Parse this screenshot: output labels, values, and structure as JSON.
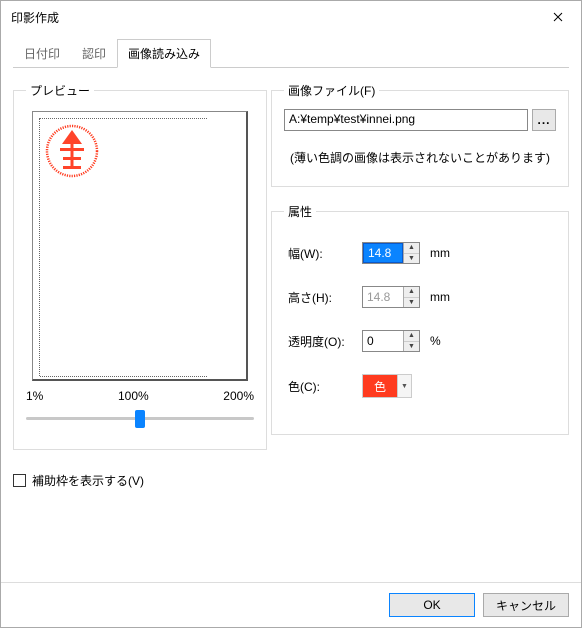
{
  "window": {
    "title": "印影作成"
  },
  "tabs": {
    "date": "日付印",
    "nin": "認印",
    "image": "画像読み込み"
  },
  "preview": {
    "legend": "プレビュー",
    "scale_min": "1%",
    "scale_mid": "100%",
    "scale_max": "200%"
  },
  "aux": {
    "checkbox_label": "補助枠を表示する(V)"
  },
  "file": {
    "legend": "画像ファイル(F)",
    "path": "A:¥temp¥test¥innei.png",
    "browse": "...",
    "hint": "(薄い色調の画像は表示されないことがあります)"
  },
  "attrs": {
    "legend": "属性",
    "width_label": "幅(W):",
    "width_value": "14.8",
    "height_label": "高さ(H):",
    "height_value": "14.8",
    "opacity_label": "透明度(O):",
    "opacity_value": "0",
    "mm": "mm",
    "pct": "%",
    "color_label": "色(C):",
    "color_value": "色"
  },
  "footer": {
    "ok": "OK",
    "cancel": "キャンセル"
  }
}
